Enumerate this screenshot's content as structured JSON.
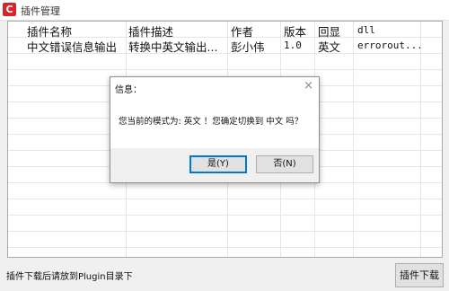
{
  "window": {
    "title": "插件管理",
    "icon_letter": "C"
  },
  "table": {
    "columns": [
      "插件名称",
      "插件描述",
      "作者",
      "版本",
      "回显",
      "dll"
    ],
    "rows": [
      [
        "中文错误信息输出",
        "转换中英文输出...",
        "彭小伟",
        "1.0",
        "英文",
        "errorout..."
      ]
    ]
  },
  "footer": {
    "hint": "插件下载后请放到Plugin目录下",
    "download_label": "插件下载"
  },
  "dialog": {
    "title": "信息：",
    "close_glyph": "×",
    "message": "您当前的模式为: 英文 ！您确定切换到 中文 吗？",
    "yes_label": "是(Y)",
    "no_label": "否(N)"
  },
  "colors": {
    "app_icon": "#d7262a",
    "focus_border": "#0078d7"
  }
}
